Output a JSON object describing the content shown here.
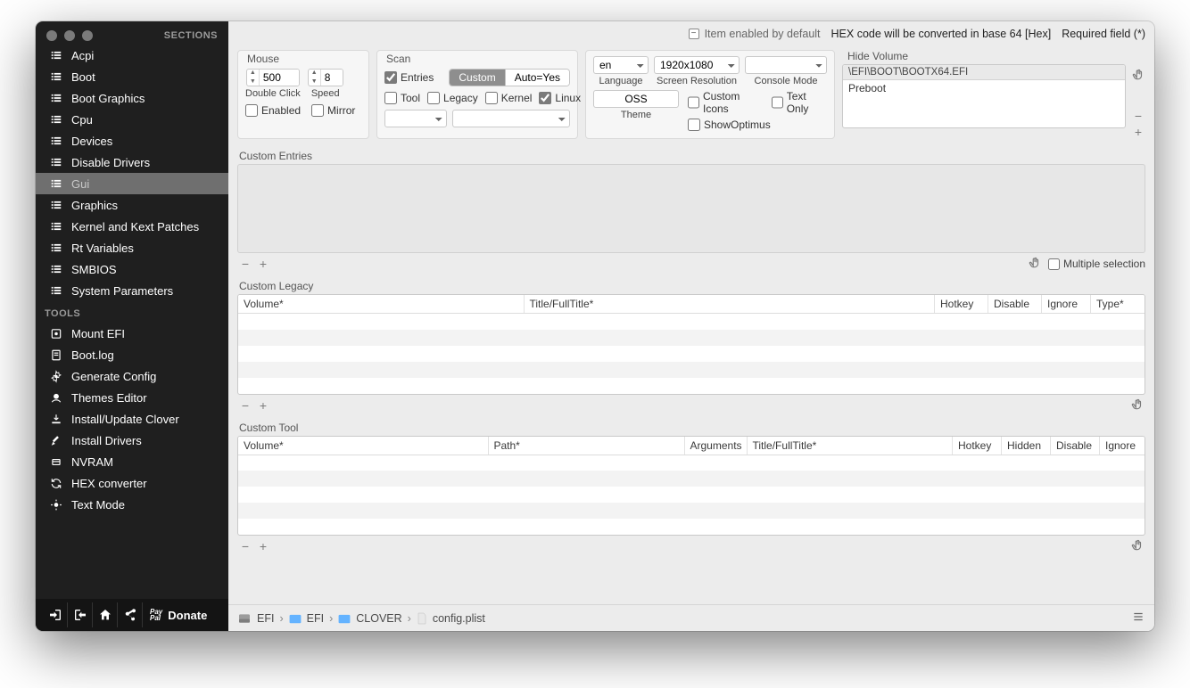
{
  "topbar": {
    "default_note": "Item enabled by default",
    "hex_note": "HEX code will be converted in base 64 [Hex]",
    "required_note": "Required field (*)"
  },
  "sidebar": {
    "sections_title": "SECTIONS",
    "tools_title": "TOOLS",
    "sections": [
      {
        "label": "Acpi"
      },
      {
        "label": "Boot"
      },
      {
        "label": "Boot Graphics"
      },
      {
        "label": "Cpu"
      },
      {
        "label": "Devices"
      },
      {
        "label": "Disable Drivers"
      },
      {
        "label": "Gui",
        "selected": true
      },
      {
        "label": "Graphics"
      },
      {
        "label": "Kernel and Kext Patches"
      },
      {
        "label": "Rt Variables"
      },
      {
        "label": "SMBIOS"
      },
      {
        "label": "System Parameters"
      }
    ],
    "tools": [
      {
        "label": "Mount EFI"
      },
      {
        "label": "Boot.log"
      },
      {
        "label": "Generate Config"
      },
      {
        "label": "Themes Editor"
      },
      {
        "label": "Install/Update Clover"
      },
      {
        "label": "Install Drivers"
      },
      {
        "label": "NVRAM"
      },
      {
        "label": "HEX converter"
      },
      {
        "label": "Text Mode"
      }
    ],
    "donate": "Donate"
  },
  "mouse": {
    "title": "Mouse",
    "double_click_value": "500",
    "double_click_label": "Double Click",
    "speed_value": "8",
    "speed_label": "Speed",
    "enabled": "Enabled",
    "mirror": "Mirror"
  },
  "scan": {
    "title": "Scan",
    "entries": "Entries",
    "tool": "Tool",
    "legacy": "Legacy",
    "kernel": "Kernel",
    "linux": "Linux",
    "seg_custom": "Custom",
    "seg_auto": "Auto=Yes"
  },
  "lang": {
    "language_value": "en",
    "language_label": "Language",
    "resolution_value": "1920x1080",
    "resolution_label": "Screen Resolution",
    "console_mode_label": "Console Mode",
    "theme_value": "OSS",
    "theme_label": "Theme",
    "custom_icons": "Custom Icons",
    "text_only": "Text Only",
    "show_optimus": "ShowOptimus"
  },
  "hide": {
    "title": "Hide Volume",
    "header": "\\EFI\\BOOT\\BOOTX64.EFI",
    "rows": [
      "Preboot"
    ]
  },
  "custom_entries": {
    "title": "Custom Entries",
    "multiple_selection": "Multiple selection"
  },
  "custom_legacy": {
    "title": "Custom Legacy",
    "cols": [
      "Volume*",
      "Title/FullTitle*",
      "Hotkey",
      "Disable",
      "Ignore",
      "Type*"
    ]
  },
  "custom_tool": {
    "title": "Custom Tool",
    "cols": [
      "Volume*",
      "Path*",
      "Arguments",
      "Title/FullTitle*",
      "Hotkey",
      "Hidden",
      "Disable",
      "Ignore"
    ]
  },
  "status": {
    "crumbs": [
      "EFI",
      "EFI",
      "CLOVER",
      "config.plist"
    ]
  }
}
